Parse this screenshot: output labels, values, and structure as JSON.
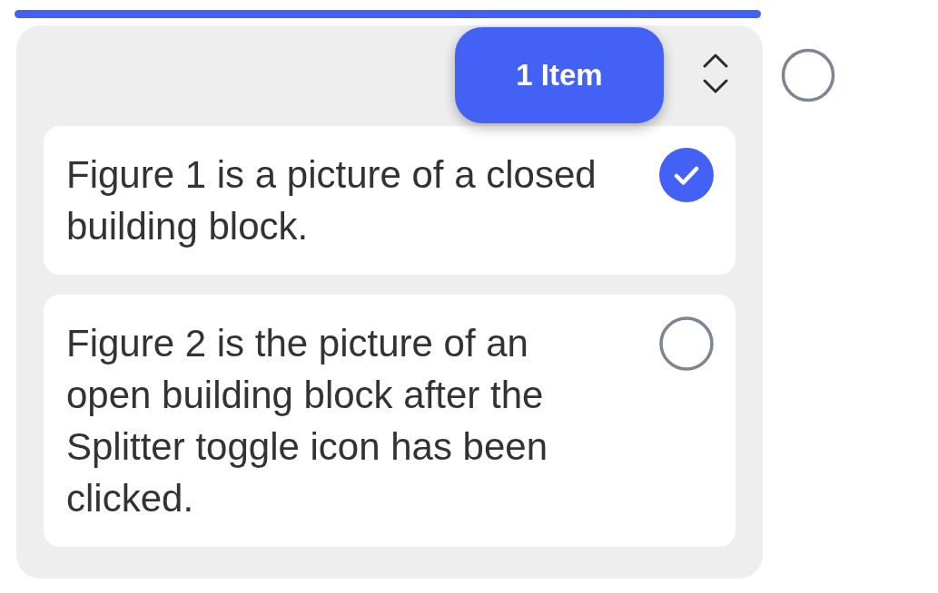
{
  "group": {
    "drag_badge": {
      "label": "1 Item"
    },
    "items": [
      {
        "text": "Figure 1 is a picture of a closed building block.",
        "checked": true
      },
      {
        "text": "Figure 2 is the picture of an open building block after the Splitter toggle icon has been clicked.",
        "checked": false
      }
    ]
  },
  "radio": {
    "selected": false
  }
}
